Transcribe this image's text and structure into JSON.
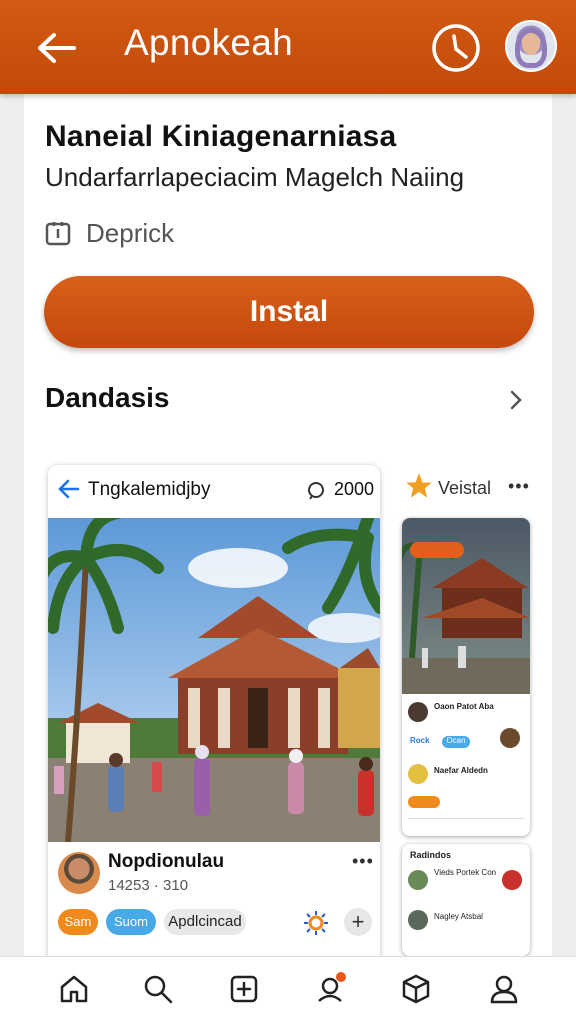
{
  "header": {
    "title": "Apnokeah",
    "colors": {
      "bar": "#c9500e",
      "accent": "#e8561a"
    },
    "icons": [
      "back-arrow-icon",
      "clock-icon",
      "avatar"
    ]
  },
  "app": {
    "name": "Naneial Kiniagenarniasa",
    "subtitle": "Undarfarrlapeciacim Magelch Naiing",
    "developer": "Deprick",
    "install_label": "Instal"
  },
  "section": {
    "title": "Dandasis"
  },
  "card": {
    "title": "Tngkalemidjby",
    "comment_count": "2000",
    "poster_name": "Nopdionulau",
    "poster_stats": "14253 · 310",
    "chips": [
      "Sam",
      "Suom",
      "Apdlcincad"
    ]
  },
  "right": {
    "label": "Veistal",
    "rows": [
      "Oaon Patot Aba",
      "Naefar Aldedn",
      "Rock",
      "Ocan"
    ],
    "card2_title": "Radindos",
    "card2_rows": [
      "Vieds Portek Con",
      "Nagley Atsbal"
    ]
  },
  "nav": {
    "items": [
      "home-icon",
      "search-icon",
      "add-icon",
      "notifications-icon",
      "package-icon",
      "profile-icon"
    ]
  }
}
